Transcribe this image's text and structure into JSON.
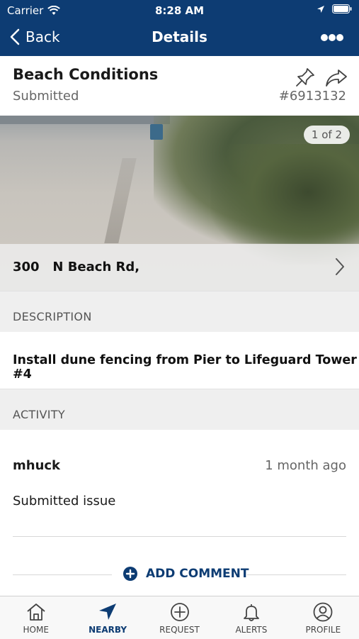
{
  "status_bar": {
    "carrier": "Carrier",
    "time": "8:28 AM"
  },
  "nav": {
    "back_label": "Back",
    "title": "Details"
  },
  "issue": {
    "title": "Beach Conditions",
    "status": "Submitted",
    "id": "#6913132",
    "photo_counter": "1 of 2",
    "address": "300   N Beach Rd,"
  },
  "description": {
    "header": "DESCRIPTION",
    "text": "Install dune fencing from Pier to Lifeguard Tower #4"
  },
  "activity": {
    "header": "ACTIVITY",
    "items": [
      {
        "user": "mhuck",
        "time": "1 month ago",
        "message": "Submitted issue"
      }
    ],
    "add_comment_label": "ADD COMMENT"
  },
  "tabs": [
    {
      "label": "HOME",
      "icon": "home-icon"
    },
    {
      "label": "NEARBY",
      "icon": "location-arrow-icon",
      "active": true
    },
    {
      "label": "REQUEST",
      "icon": "plus-circle-icon"
    },
    {
      "label": "ALERTS",
      "icon": "bell-icon"
    },
    {
      "label": "PROFILE",
      "icon": "person-icon"
    }
  ],
  "colors": {
    "brand": "#0d3c73",
    "section_bg": "#efefef"
  }
}
